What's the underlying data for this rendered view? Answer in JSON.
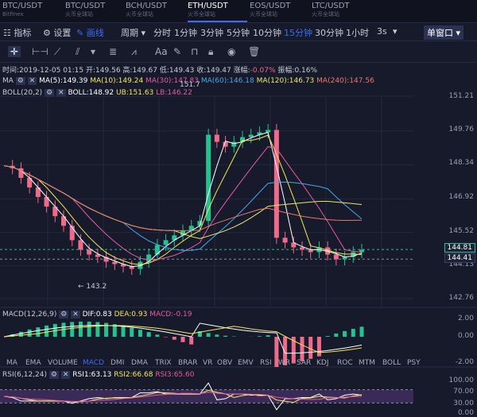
{
  "tabs": [
    {
      "pair": "BTC/USDT",
      "exchange": "Bitfinex",
      "active": false
    },
    {
      "pair": "BTC/USDT",
      "exchange": "火币全球站",
      "active": false
    },
    {
      "pair": "BCH/USDT",
      "exchange": "火币全球站",
      "active": false
    },
    {
      "pair": "ETH/USDT",
      "exchange": "火币全球站",
      "active": true
    },
    {
      "pair": "EOS/USDT",
      "exchange": "火币全球站",
      "active": false
    },
    {
      "pair": "LTC/USDT",
      "exchange": "火币全球站",
      "active": false
    }
  ],
  "toolbar": {
    "indicator": "指标",
    "settings": "设置",
    "draw": "画线",
    "period": "周期",
    "intervals": [
      "分时",
      "1分钟",
      "3分钟",
      "5分钟",
      "10分钟",
      "15分钟",
      "30分钟",
      "1小时"
    ],
    "active_interval": "15分钟",
    "refresh": "3s",
    "window": "单窗口"
  },
  "info": {
    "line1": {
      "time": "时间:2019-12-05 01:15",
      "open": "开:149.56",
      "high": "高:149.67",
      "low": "低:149.43",
      "close": "收:149.47",
      "change_label": "涨幅:",
      "change": "-0.07%",
      "amp": "振幅:0.16%"
    },
    "ma": {
      "label": "MA",
      "ma5": "MA(5):149.39",
      "ma10": "MA(10):149.24",
      "ma30": "MA(30):147.83",
      "ma60": "MA(60):146.18",
      "ma120": "MA(120):146.73",
      "ma240": "MA(240):147.56"
    },
    "boll": {
      "label": "BOLL(20,2)",
      "boll": "BOLL:148.92",
      "ub": "UB:151.63",
      "lb": "LB:146.22"
    }
  },
  "price_axis": [
    "151.21",
    "149.76",
    "148.34",
    "146.92",
    "145.52",
    "144.13",
    "142.76"
  ],
  "current_price": "144.81",
  "cursor_price": "144.41",
  "high_mark": "151.7",
  "low_mark": "← 143.2",
  "macd": {
    "label": "MACD(12,26,9)",
    "dif": "DIF:0.83",
    "dea": "DEA:0.93",
    "macd": "MACD:-0.19",
    "axis": [
      "2.00",
      "0.00",
      "-2.00"
    ]
  },
  "ind_tabs": [
    "MA",
    "EMA",
    "VOLUME",
    "MACD",
    "DMI",
    "DMA",
    "TRIX",
    "BRAR",
    "VR",
    "OBV",
    "EMV",
    "RSI",
    "WR",
    "SAR",
    "KDJ",
    "ROC",
    "MTM",
    "BOLL",
    "PSY"
  ],
  "active_ind": "MACD",
  "rsi": {
    "label": "RSI(6,12,24)",
    "rsi1": "RSI1:63.13",
    "rsi2": "RSI2:66.68",
    "rsi3": "RSI3:65.60",
    "axis": [
      "100.00",
      "70.00",
      "30.00",
      "0.00"
    ]
  },
  "colors": {
    "up": "#24c28f",
    "down": "#f06a8a",
    "ma5": "#ffffff",
    "ma10": "#f2e85a",
    "ma30": "#e75aa6",
    "ma60": "#4aa6e8",
    "ma120": "#e8e86b",
    "ma240": "#e87a6b",
    "accent": "#3b6ef5"
  }
}
